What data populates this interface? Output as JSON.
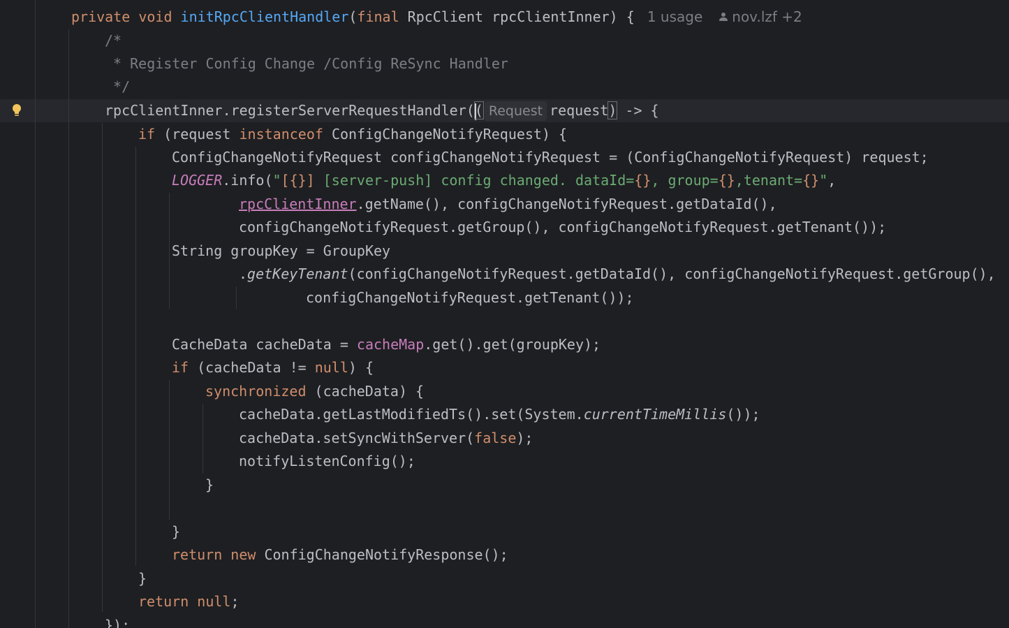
{
  "editor": {
    "colors": {
      "background": "#1e1f22",
      "current_line": "#26282e",
      "keyword": "#cf8e6d",
      "function": "#56a8f5",
      "comment": "#7a7e85",
      "string": "#6aab73",
      "field": "#c77dbb"
    },
    "icons": {
      "gutter": "lightbulb-icon",
      "author": "person-icon"
    },
    "lines": [
      {
        "segments": [
          {
            "t": "private ",
            "c": "kw"
          },
          {
            "t": "void ",
            "c": "kw"
          },
          {
            "t": "initRpcClientHandler",
            "c": "fn"
          },
          {
            "t": "(",
            "c": ""
          },
          {
            "t": "final ",
            "c": "kw"
          },
          {
            "t": "RpcClient rpcClientInner) { ",
            "c": ""
          }
        ],
        "usage": "1 usage",
        "author": "nov.lzf +2"
      },
      {
        "segments": [
          {
            "t": "/*",
            "c": "cm"
          }
        ]
      },
      {
        "segments": [
          {
            "t": " * Register Config Change /Config ReSync Handler",
            "c": "cm"
          }
        ]
      },
      {
        "segments": [
          {
            "t": " */",
            "c": "cm"
          }
        ]
      },
      {
        "segments": [
          {
            "t": "rpcClientInner.registerServerRequestHandler(",
            "c": ""
          },
          {
            "t": "(",
            "c": "match"
          },
          {
            "t": "Request",
            "c": "hint"
          },
          {
            "t": "request",
            "c": ""
          },
          {
            "t": ")",
            "c": "match"
          },
          {
            "t": " -> {",
            "c": ""
          }
        ]
      },
      {
        "segments": [
          {
            "t": "if ",
            "c": "kw"
          },
          {
            "t": "(request ",
            "c": ""
          },
          {
            "t": "instanceof ",
            "c": "kw"
          },
          {
            "t": "ConfigChangeNotifyRequest) {",
            "c": ""
          }
        ]
      },
      {
        "segments": [
          {
            "t": "ConfigChangeNotifyRequest configChangeNotifyRequest = (ConfigChangeNotifyRequest) request;",
            "c": ""
          }
        ]
      },
      {
        "segments": [
          {
            "t": "LOGGER",
            "c": "static-it"
          },
          {
            "t": ".info(",
            "c": ""
          },
          {
            "t": "\"",
            "c": "str"
          },
          {
            "t": "[{}]",
            "c": "esc"
          },
          {
            "t": " [server-push] config changed. dataId=",
            "c": "str"
          },
          {
            "t": "{}",
            "c": "esc"
          },
          {
            "t": ", group=",
            "c": "str"
          },
          {
            "t": "{}",
            "c": "esc"
          },
          {
            "t": ",tenant=",
            "c": "str"
          },
          {
            "t": "{}",
            "c": "esc"
          },
          {
            "t": "\"",
            "c": "str"
          },
          {
            "t": ",",
            "c": ""
          }
        ]
      },
      {
        "segments": [
          {
            "t": "rpcClientInner",
            "c": "fld ul"
          },
          {
            "t": ".getName(), configChangeNotifyRequest.getDataId(),",
            "c": ""
          }
        ]
      },
      {
        "segments": [
          {
            "t": "configChangeNotifyRequest.getGroup(), configChangeNotifyRequest.getTenant());",
            "c": ""
          }
        ]
      },
      {
        "segments": [
          {
            "t": "String groupKey = GroupKey",
            "c": ""
          }
        ]
      },
      {
        "segments": [
          {
            "t": ".",
            "c": ""
          },
          {
            "t": "getKeyTenant",
            "c": "it"
          },
          {
            "t": "(configChangeNotifyRequest.getDataId(), configChangeNotifyRequest.getGroup(),",
            "c": ""
          }
        ]
      },
      {
        "segments": [
          {
            "t": "configChangeNotifyRequest.getTenant());",
            "c": ""
          }
        ]
      },
      {
        "segments": []
      },
      {
        "segments": [
          {
            "t": "CacheData cacheData = ",
            "c": ""
          },
          {
            "t": "cacheMap",
            "c": "fld"
          },
          {
            "t": ".get().get(groupKey);",
            "c": ""
          }
        ]
      },
      {
        "segments": [
          {
            "t": "if ",
            "c": "kw"
          },
          {
            "t": "(cacheData != ",
            "c": ""
          },
          {
            "t": "null",
            "c": "kw"
          },
          {
            "t": ") {",
            "c": ""
          }
        ]
      },
      {
        "segments": [
          {
            "t": "synchronized ",
            "c": "kw"
          },
          {
            "t": "(cacheData) {",
            "c": ""
          }
        ]
      },
      {
        "segments": [
          {
            "t": "cacheData.getLastModifiedTs().set(System.",
            "c": ""
          },
          {
            "t": "currentTimeMillis",
            "c": "it"
          },
          {
            "t": "());",
            "c": ""
          }
        ]
      },
      {
        "segments": [
          {
            "t": "cacheData.setSyncWithServer(",
            "c": ""
          },
          {
            "t": "false",
            "c": "kw"
          },
          {
            "t": ");",
            "c": ""
          }
        ]
      },
      {
        "segments": [
          {
            "t": "notifyListenConfig();",
            "c": ""
          }
        ]
      },
      {
        "segments": [
          {
            "t": "}",
            "c": ""
          }
        ]
      },
      {
        "segments": []
      },
      {
        "segments": [
          {
            "t": "}",
            "c": ""
          }
        ]
      },
      {
        "segments": [
          {
            "t": "return ",
            "c": "kw"
          },
          {
            "t": "new ",
            "c": "kw"
          },
          {
            "t": "ConfigChangeNotifyResponse();",
            "c": ""
          }
        ]
      },
      {
        "segments": [
          {
            "t": "}",
            "c": ""
          }
        ]
      },
      {
        "segments": [
          {
            "t": "return ",
            "c": "kw"
          },
          {
            "t": "null",
            "c": "kw"
          },
          {
            "t": ";",
            "c": ""
          }
        ]
      },
      {
        "segments": [
          {
            "t": "});",
            "c": ""
          }
        ]
      }
    ]
  }
}
